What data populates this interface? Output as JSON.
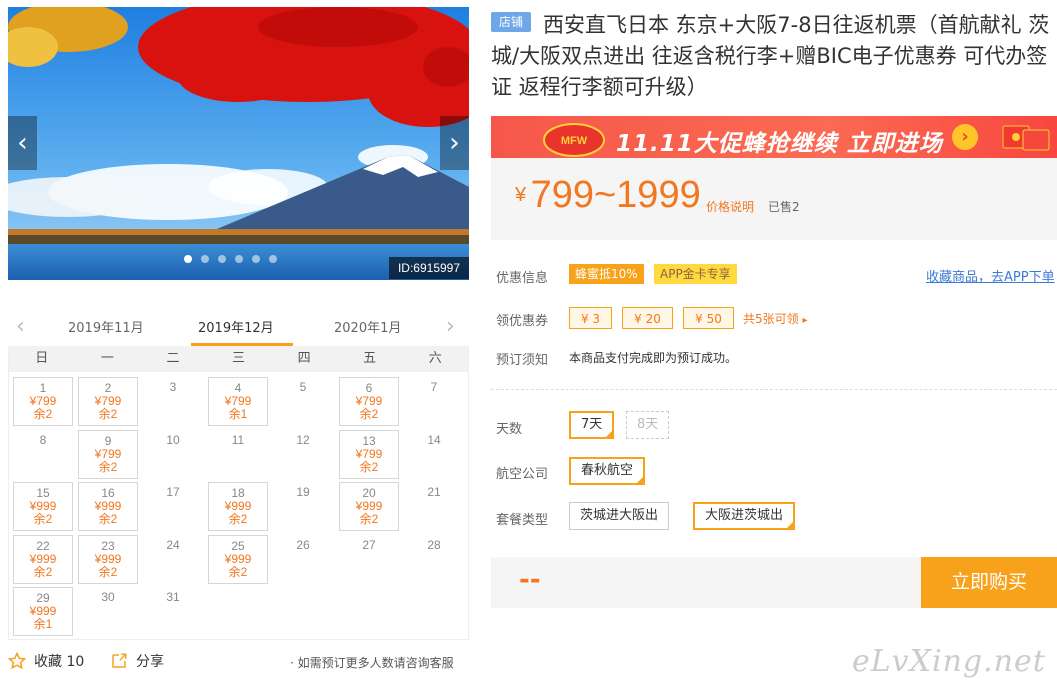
{
  "gallery": {
    "photo_id": "ID:6915997",
    "prev_icon": "‹",
    "next_icon": "›",
    "dot_count": 6
  },
  "calendar": {
    "months": [
      "2019年11月",
      "2019年12月",
      "2020年1月"
    ],
    "selected_month": "2019年12月",
    "weekdays": [
      "日",
      "一",
      "二",
      "三",
      "四",
      "五",
      "六"
    ],
    "weeks": [
      [
        {
          "d": "1",
          "p": "¥799",
          "s": "余2"
        },
        {
          "d": "2",
          "p": "¥799",
          "s": "余2"
        },
        {
          "d": "3"
        },
        {
          "d": "4",
          "p": "¥799",
          "s": "余1"
        },
        {
          "d": "5"
        },
        {
          "d": "6",
          "p": "¥799",
          "s": "余2"
        },
        {
          "d": "7"
        }
      ],
      [
        {
          "d": "8"
        },
        {
          "d": "9",
          "p": "¥799",
          "s": "余2"
        },
        {
          "d": "10"
        },
        {
          "d": "11"
        },
        {
          "d": "12"
        },
        {
          "d": "13",
          "p": "¥799",
          "s": "余2"
        },
        {
          "d": "14"
        }
      ],
      [
        {
          "d": "15",
          "p": "¥999",
          "s": "余2"
        },
        {
          "d": "16",
          "p": "¥999",
          "s": "余2"
        },
        {
          "d": "17"
        },
        {
          "d": "18",
          "p": "¥999",
          "s": "余2"
        },
        {
          "d": "19"
        },
        {
          "d": "20",
          "p": "¥999",
          "s": "余2"
        },
        {
          "d": "21"
        }
      ],
      [
        {
          "d": "22",
          "p": "¥999",
          "s": "余2"
        },
        {
          "d": "23",
          "p": "¥999",
          "s": "余2"
        },
        {
          "d": "24"
        },
        {
          "d": "25",
          "p": "¥999",
          "s": "余2"
        },
        {
          "d": "26"
        },
        {
          "d": "27"
        },
        {
          "d": "28"
        }
      ],
      [
        {
          "d": "29",
          "p": "¥999",
          "s": "余1"
        },
        {
          "d": "30"
        },
        {
          "d": "31"
        }
      ]
    ]
  },
  "footer": {
    "favorite_label": "收藏 10",
    "share_label": "分享",
    "consult_note": "· 如需预订更多人数请咨询客服",
    "watermark": "eLvXing.net"
  },
  "product": {
    "shop_tag": "店铺",
    "title": "西安直飞日本 东京+大阪7-8日往返机票（首航献礼 茨城/大阪双点进出 往返含税行李+赠BIC电子优惠券 可代办签证 返程行李额可升级）",
    "promo_logo": "MFW",
    "promo_text": "11.11大促蜂抢继续 立即进场",
    "price_currency": "¥",
    "price_range": "799~1999",
    "price_explain": "价格说明",
    "sold": "已售2"
  },
  "info": {
    "discount_label": "优惠信息",
    "badge_honey": "蜂蜜抵10%",
    "badge_app": "APP金卡专享",
    "favorite_link": "收藏商品，去APP下单",
    "coupon_label": "领优惠券",
    "coupons": [
      "¥ 3",
      "¥ 20",
      "¥ 50"
    ],
    "coupon_more": "共5张可领",
    "notice_label": "预订须知",
    "notice_text": "本商品支付完成即为预订成功。"
  },
  "options": {
    "days_label": "天数",
    "days": [
      "7天",
      "8天"
    ],
    "airline_label": "航空公司",
    "airline": "春秋航空",
    "package_label": "套餐类型",
    "packages": [
      "茨城进大阪出",
      "大阪进茨城出"
    ]
  },
  "buy": {
    "placeholder": "--",
    "button": "立即购买"
  },
  "colors": {
    "accent": "#f7a21a",
    "price": "#f2771f",
    "link": "#3a7bd5"
  }
}
